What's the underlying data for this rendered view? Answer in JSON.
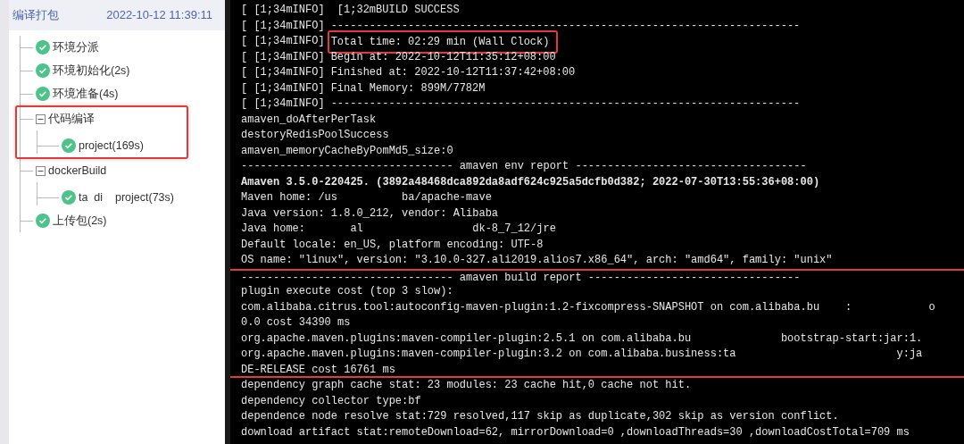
{
  "sidebar": {
    "title": "编译打包",
    "timestamp": "2022-10-12 11:39:11",
    "tree": [
      {
        "label": "环境分派",
        "highlighted": false
      },
      {
        "label": "环境初始化(2s)",
        "highlighted": false
      },
      {
        "label": "环境准备(4s)",
        "highlighted": false
      },
      {
        "label": "代码编译",
        "expanded": true,
        "highlighted": true,
        "children": [
          {
            "label": "project(169s)"
          }
        ]
      },
      {
        "label": "dockerBuild",
        "expanded": true,
        "highlighted": false,
        "children": [
          {
            "label": "ta  di    project(73s)"
          }
        ]
      },
      {
        "label": "上传包(2s)",
        "highlighted": false
      }
    ]
  },
  "terminal": {
    "lines": [
      {
        "prefix": "[ [1;34mINFO]",
        "text": " [1;32mBUILD SUCCESS",
        "highlighted": false
      },
      {
        "prefix": "[ [1;34mINFO]",
        "text": "-------------------------------------------------------------------------",
        "highlighted": false
      },
      {
        "prefix": "[ [1;34mINFO]",
        "text": "Total time: 02:29 min (Wall Clock)",
        "highlighted": true
      },
      {
        "prefix": "[ [1;34mINFO]",
        "text": "Begin at: 2022-10-12T11:35:12+08:00",
        "highlighted": false
      },
      {
        "prefix": "[ [1;34mINFO]",
        "text": "Finished at: 2022-10-12T11:37:42+08:00",
        "highlighted": false
      },
      {
        "prefix": "[ [1;34mINFO]",
        "text": "Final Memory: 899M/7782M",
        "highlighted": false
      },
      {
        "prefix": "[ [1;34mINFO]",
        "text": "-------------------------------------------------------------------------",
        "highlighted": false
      },
      {
        "text": "amaven_doAfterPerTask",
        "highlighted": false
      },
      {
        "text": "destoryRedisPoolSuccess",
        "highlighted": false
      },
      {
        "text": "amaven_memoryCacheByPomMd5_size:0",
        "highlighted": false
      },
      {
        "text": "--------------------------------- amaven env report ------------------------------------",
        "highlighted": false
      },
      {
        "text": "Amaven 3.5.0-220425. (3892a48468dca892da8adf624c925a5dcfb0d382; 2022-07-30T13:55:36+08:00)",
        "highlighted": false,
        "bold": true
      },
      {
        "text": "Maven home: /us          ba/apache-mave",
        "highlighted": false
      },
      {
        "text": "Java version: 1.8.0_212, vendor: Alibaba",
        "highlighted": false
      },
      {
        "text": "Java home:       al                 dk-8_7_12/jre",
        "highlighted": false
      },
      {
        "text": "Default locale: en_US, platform encoding: UTF-8",
        "highlighted": false
      },
      {
        "text": "OS name: \"linux\", version: \"3.10.0-327.ali2019.alios7.x86_64\", arch: \"amd64\", family: \"unix\"",
        "highlighted": false
      },
      {
        "text": "--------------------------------- amaven build report ---------------------------------",
        "highlighted": true
      },
      {
        "text": "plugin execute cost (top 3 slow):",
        "highlighted": true
      },
      {
        "text": "com.alibaba.citrus.tool:autoconfig-maven-plugin:1.2-fixcompress-SNAPSHOT on com.alibaba.bu    :            o",
        "highlighted": true
      },
      {
        "text": "0.0 cost 34390 ms",
        "highlighted": true
      },
      {
        "text": "org.apache.maven.plugins:maven-compiler-plugin:2.5.1 on com.alibaba.bu              bootstrap-start:jar:1.",
        "highlighted": true
      },
      {
        "text": "org.apache.maven.plugins:maven-compiler-plugin:3.2 on com.alibaba.business:ta                         y:ja",
        "highlighted": true
      },
      {
        "text": "DE-RELEASE cost 16761 ms",
        "highlighted": true
      },
      {
        "text": "dependency graph cache stat: 23 modules: 23 cache hit,0 cache not hit.",
        "highlighted": false
      },
      {
        "text": "dependency collector type:bf",
        "highlighted": false
      },
      {
        "text": "dependence node resolve stat:729 resolved,117 skip as duplicate,302 skip as version conflict.",
        "highlighted": false
      },
      {
        "text": "download artifact stat:remoteDownload=62, mirrorDownload=0 ,downloadThreads=30 ,downloadCostTotal=709 ms",
        "highlighted": false
      }
    ]
  }
}
